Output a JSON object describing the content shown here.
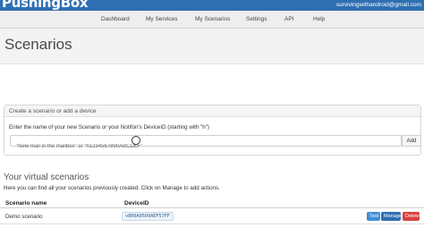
{
  "app": {
    "logo_text": "PushingBox",
    "user_email": "survivingwithandroid@gmail.com"
  },
  "nav": {
    "items": [
      "Dashboard",
      "My Services",
      "My Scenarios",
      "Settings",
      "API",
      "Help"
    ]
  },
  "page": {
    "title": "Scenarios"
  },
  "create_panel": {
    "heading": "Create a scenario or add a device",
    "label": "Enter the name of your new Scenario or your Notifon's DeviceID (starting with \"h\")",
    "input_value": "",
    "input_placeholder": "\"New mail in the mailbox\" or \"h1234567890ABCDEF\"",
    "add_label": "Add"
  },
  "scenarios": {
    "title": "Your virtual scenarios",
    "description": "Here you can find all your scenarios previously created. Click on Manage to add actions.",
    "columns": [
      "Scenario name",
      "DeviceID"
    ],
    "rows": [
      {
        "name": "Demo scenario",
        "device_id": "v800A0509AEF57FF",
        "actions": [
          "Test",
          "Manage",
          "Delete"
        ]
      }
    ]
  },
  "colors": {
    "topbar": "#2f6fb2",
    "nav_bg": "#eeeeee",
    "test_btn": "#3f8fd8",
    "manage_btn": "#2f6fb2",
    "delete_btn": "#d8413b"
  }
}
